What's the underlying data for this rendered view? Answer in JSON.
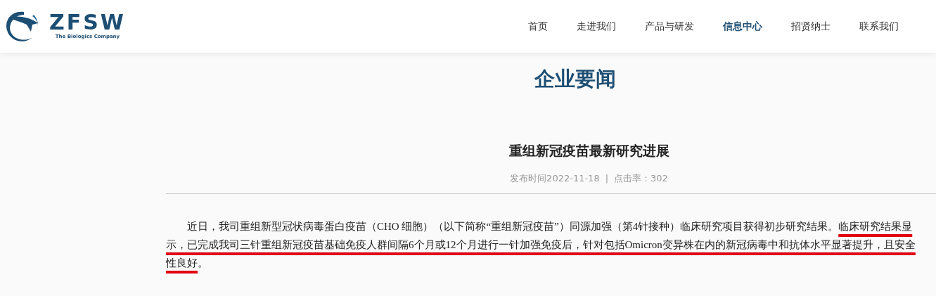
{
  "logo": {
    "name": "ZFSW",
    "tagline": "The Biologics Company"
  },
  "nav": [
    {
      "label": "首页",
      "selected": false
    },
    {
      "label": "走进我们",
      "selected": false
    },
    {
      "label": "产品与研发",
      "selected": false
    },
    {
      "label": "信息中心",
      "selected": true
    },
    {
      "label": "招贤纳士",
      "selected": false
    },
    {
      "label": "联系我们",
      "selected": false
    }
  ],
  "section_title": "企业要闻",
  "article": {
    "title": "重组新冠疫苗最新研究进展",
    "published": "发布时间2022-11-18",
    "separator": "|",
    "views": "点击率：302",
    "body": {
      "text": "近日，我司重组新型冠状病毒蛋白疫苗（CHO 细胞）（以下简称“重组新冠疫苗”）同源加强（第4针接种）临床研究项目获得初步研究结果。",
      "highlight": "临床研究结果显示，已完成我司三针重组新冠疫苗基础免疫人群间隔6个月或12个月进行一针加强免疫后，针对包括Omicron变异株在内的新冠病毒中和抗体水平显著提升，且安全性良好",
      "end": "。"
    }
  }
}
